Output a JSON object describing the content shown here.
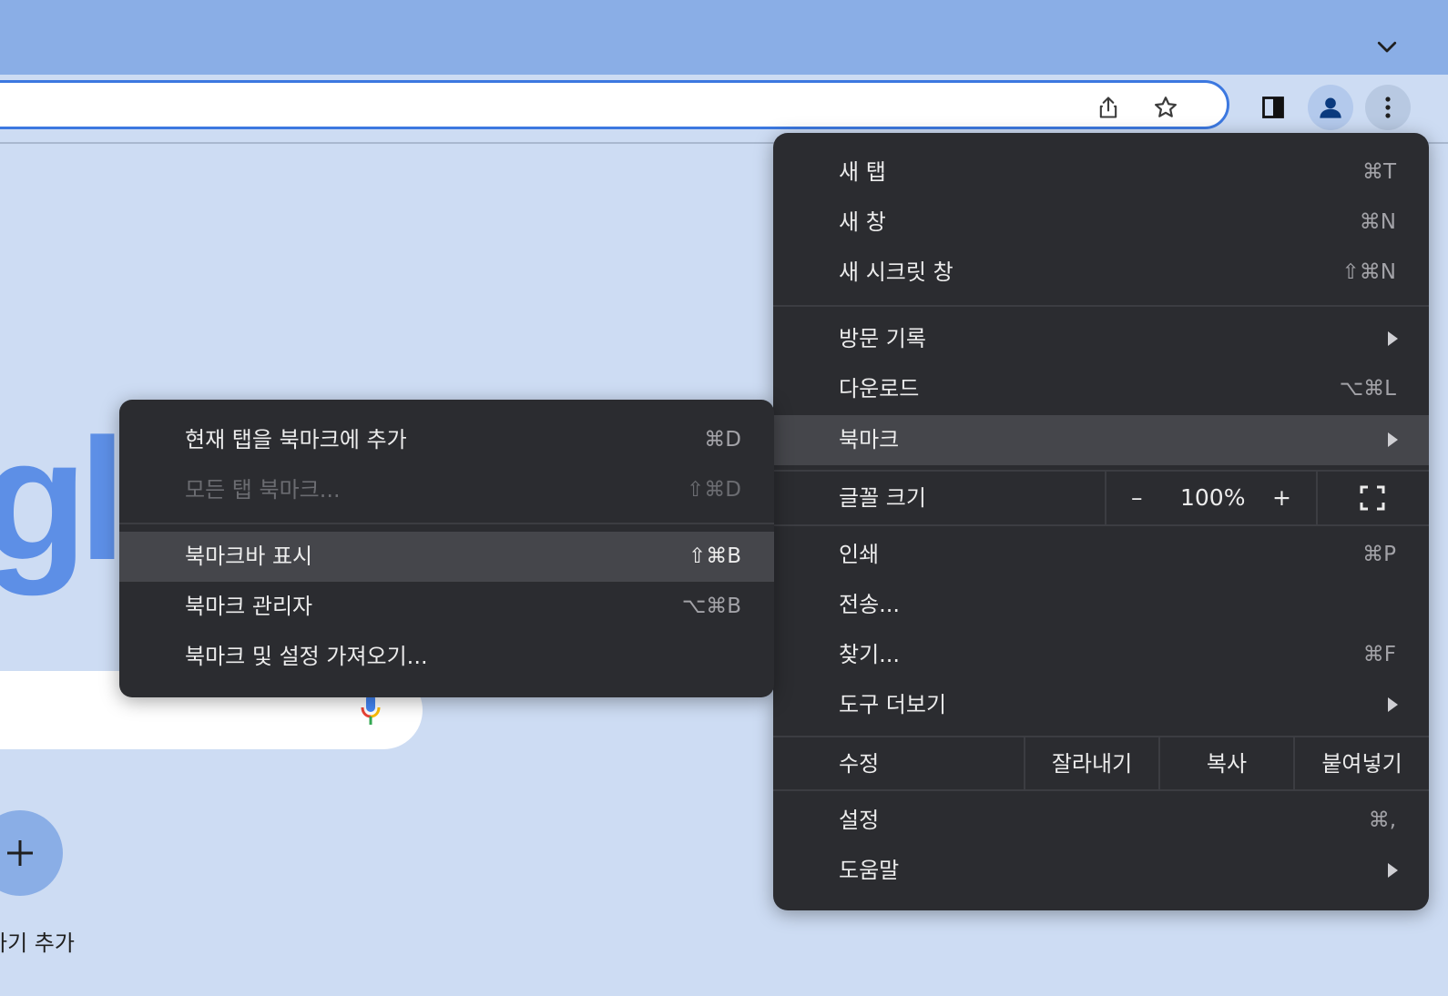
{
  "browser": {
    "tab_strip_menu_icon": "chevron-down-icon",
    "toolbar": {
      "share_icon": "share-icon",
      "bookmark_star_icon": "star-icon",
      "side_panel_icon": "side-panel-icon",
      "profile_icon": "profile-icon",
      "menu_icon": "more-vertical-icon"
    }
  },
  "ntp": {
    "logo_text": "gle",
    "add_shortcut_label": "가기 추가"
  },
  "main_menu": {
    "new_tab": {
      "label": "새 탭",
      "shortcut": "⌘T"
    },
    "new_window": {
      "label": "새 창",
      "shortcut": "⌘N"
    },
    "new_incognito": {
      "label": "새 시크릿 창",
      "shortcut": "⇧⌘N"
    },
    "history": {
      "label": "방문 기록"
    },
    "downloads": {
      "label": "다운로드",
      "shortcut": "⌥⌘L"
    },
    "bookmarks": {
      "label": "북마크"
    },
    "zoom": {
      "label": "글꼴 크기",
      "minus": "–",
      "value": "100%",
      "plus": "+"
    },
    "print": {
      "label": "인쇄",
      "shortcut": "⌘P"
    },
    "cast": {
      "label": "전송..."
    },
    "find": {
      "label": "찾기...",
      "shortcut": "⌘F"
    },
    "more_tools": {
      "label": "도구 더보기"
    },
    "edit": {
      "label": "수정",
      "cut": "잘라내기",
      "copy": "복사",
      "paste": "붙여넣기"
    },
    "settings": {
      "label": "설정",
      "shortcut": "⌘,"
    },
    "help": {
      "label": "도움말"
    }
  },
  "bookmarks_submenu": {
    "add_current": {
      "label": "현재 탭을 북마크에 추가",
      "shortcut": "⌘D"
    },
    "bookmark_all": {
      "label": "모든 탭 북마크...",
      "shortcut": "⇧⌘D"
    },
    "show_bar": {
      "label": "북마크바 표시",
      "shortcut": "⇧⌘B"
    },
    "manager": {
      "label": "북마크 관리자",
      "shortcut": "⌥⌘B"
    },
    "import": {
      "label": "북마크 및 설정 가져오기..."
    }
  }
}
